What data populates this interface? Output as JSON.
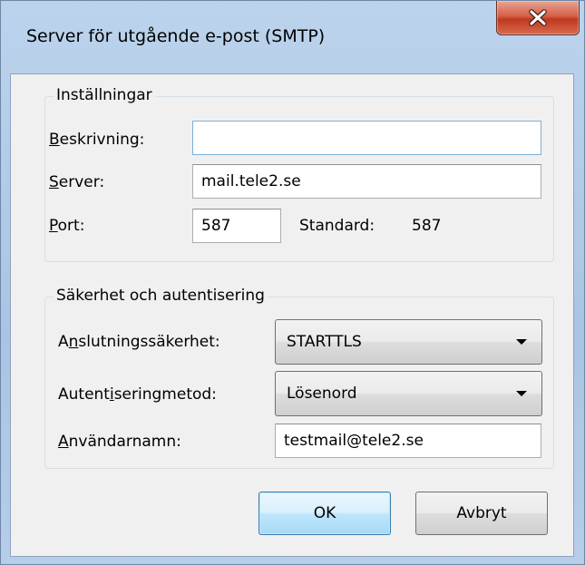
{
  "window": {
    "title": "Server för utgående e-post (SMTP)"
  },
  "settings_group": {
    "legend": "Inställningar",
    "description_label": "Beskrivning:",
    "description_accesskey": "B",
    "description_rest": "eskrivning:",
    "description_value": "",
    "server_label": "Server:",
    "server_accesskey": "S",
    "server_rest": "erver:",
    "server_value": "mail.tele2.se",
    "port_label": "Port:",
    "port_accesskey": "P",
    "port_rest": "ort:",
    "port_value": "587",
    "default_label": "Standard:",
    "default_value": "587"
  },
  "security_group": {
    "legend": "Säkerhet och autentisering",
    "connection_label": "Anslutningssäkerhet:",
    "connection_pre": "A",
    "connection_accesskey": "n",
    "connection_rest": "slutningssäkerhet:",
    "connection_value": "STARTTLS",
    "auth_label": "Autentiseringmetod:",
    "auth_pre": "Autent",
    "auth_accesskey": "i",
    "auth_rest": "seringmetod:",
    "auth_value": "Lösenord",
    "username_label": "Användarnamn:",
    "username_accesskey": "A",
    "username_rest": "nvändarnamn:",
    "username_value": "testmail@tele2.se"
  },
  "buttons": {
    "ok": "OK",
    "cancel": "Avbryt"
  },
  "icons": {
    "close": "close-icon",
    "dropdown": "chevron-down-icon"
  },
  "colors": {
    "close_button": "#c7432a",
    "default_button_border": "#3c7fb1",
    "focus_border": "#7ab1d8"
  }
}
